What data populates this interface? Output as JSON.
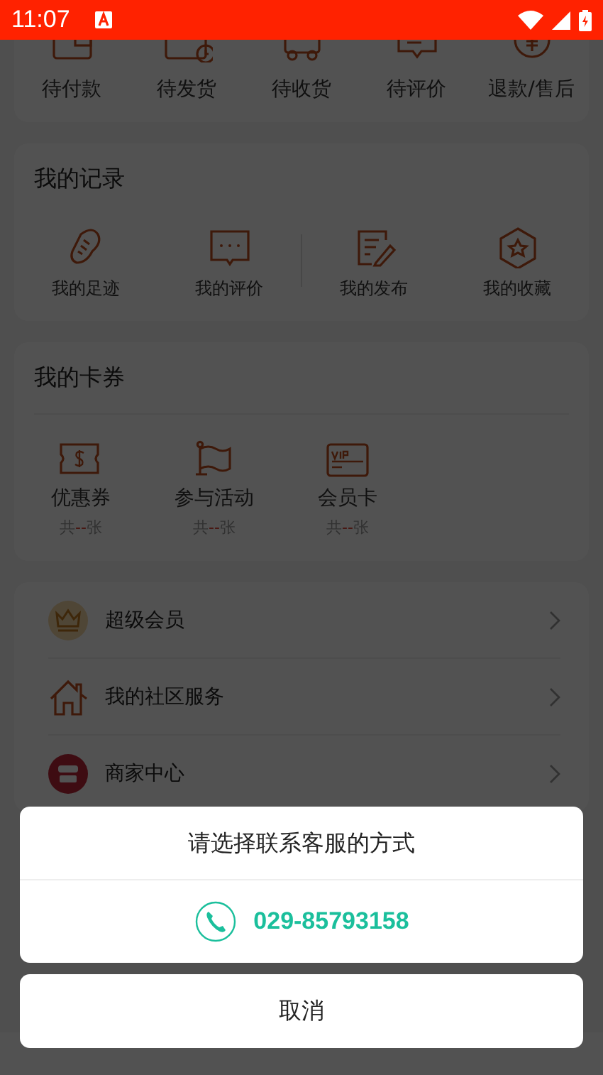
{
  "status_bar": {
    "time": "11:07"
  },
  "orders": {
    "items": [
      {
        "label": "待付款"
      },
      {
        "label": "待发货"
      },
      {
        "label": "待收货"
      },
      {
        "label": "待评价"
      },
      {
        "label": "退款/售后"
      }
    ]
  },
  "records": {
    "title": "我的记录",
    "items": [
      {
        "label": "我的足迹"
      },
      {
        "label": "我的评价"
      },
      {
        "label": "我的发布"
      },
      {
        "label": "我的收藏"
      }
    ]
  },
  "coupons": {
    "title": "我的卡券",
    "items": [
      {
        "label": "优惠券",
        "count_prefix": "共",
        "count": "--",
        "count_suffix": "张"
      },
      {
        "label": "参与活动",
        "count_prefix": "共",
        "count": "--",
        "count_suffix": "张"
      },
      {
        "label": "会员卡",
        "count_prefix": "共",
        "count": "--",
        "count_suffix": "张"
      }
    ]
  },
  "menu": {
    "items": [
      {
        "label": "超级会员"
      },
      {
        "label": "我的社区服务"
      },
      {
        "label": "商家中心"
      }
    ]
  },
  "dialog": {
    "title": "请选择联系客服的方式",
    "phone": "029-85793158",
    "cancel": "取消"
  }
}
